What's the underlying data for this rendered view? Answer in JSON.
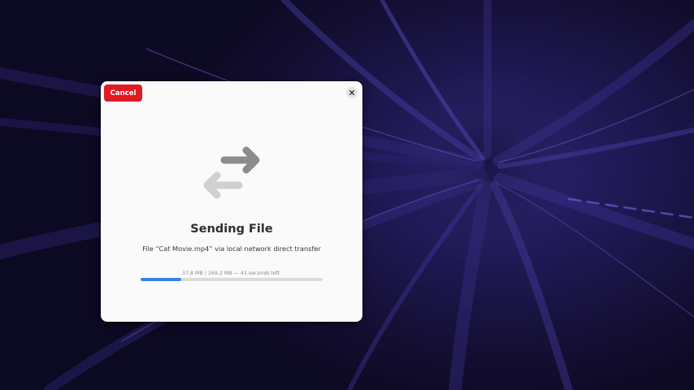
{
  "dialog": {
    "cancel_label": "Cancel",
    "close_icon": "close-icon",
    "transfer_icon": "transfer-arrows-icon",
    "title": "Sending File",
    "subtitle": "File “Cat Movie.mp4” via local network direct transfer",
    "progress_text": "37,8 MB / 169,2 MB — 41 seconds left",
    "progress_fraction": 0.223,
    "accent_color": "#3584e4",
    "destructive_color": "#e01b24"
  }
}
